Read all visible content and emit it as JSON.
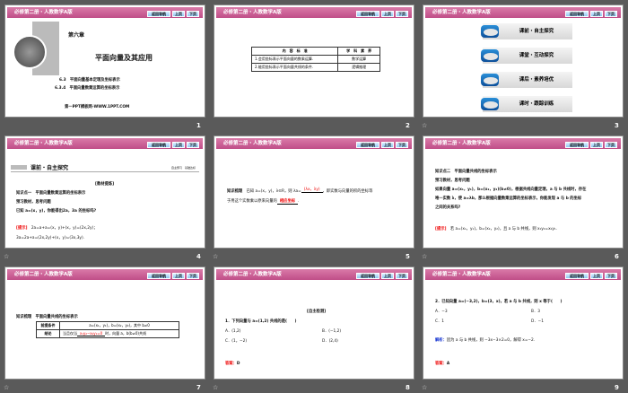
{
  "header": {
    "title": "必修第二册・人教数学A版",
    "nav_home": "返回导航",
    "nav_prev": "上页",
    "nav_next": "下页"
  },
  "slides": [
    {
      "number": "1",
      "chapter": "第六章",
      "chapter_title": "平面向量及其应用",
      "section1": "6.3　平面向量基本定理及坐标表示",
      "section2": "6.3.4　平面向量数乘运算的坐标表示",
      "footer": "第一PPT模板网-WWW.1PPT.COM"
    },
    {
      "number": "2",
      "table": {
        "headers": [
          "内　容　标　准",
          "学　科　素　养"
        ],
        "rows": [
          [
            "1.会用坐标表示平面向量的数乘运算.",
            "数学运算"
          ],
          [
            "2.能用坐标表示平面向量共线的条件.",
            "逻辑推理"
          ]
        ]
      }
    },
    {
      "number": "3",
      "menu": [
        "课前・自主探究",
        "课堂・互动探究",
        "课后・素养培优",
        "课时・跟踪训练"
      ]
    },
    {
      "number": "4",
      "section": "课前・自主探究",
      "section_right": "自主预习　基础达标",
      "label": "[教材提炼]",
      "lines": [
        "知识点一　平面向量数乘运算的坐标表示",
        "预习教材，思考问题",
        "已知 a=(x，y)，你能得出2a，3a 的坐标吗?"
      ],
      "hint": "[提示]",
      "ans1": "2a=a+a=(x，y)+(x，y)=(2x,2y)；",
      "ans2": "3a=2a+a=(2x,2y)+(x，y)=(3x,3y)."
    },
    {
      "number": "5",
      "prefix": "知识梳理",
      "text1": "已知 a=(x，y)，λ∈R，则 λa=",
      "blank1": "(λx，λy)",
      "text2": "，即实数与向量的积的坐标等",
      "text3": "于用这个实数乘以原来向量的",
      "blank2": "相应坐标",
      "text4": "."
    },
    {
      "number": "6",
      "lines": [
        "知识点二　平面向量共线的坐标表示",
        "预习教材，思考问题",
        "如果向量 a=(x₁，y₁)，b=(x₂，y₂)(b≠0)，根据共线向量定理，a 与 b 共线时，存在",
        "唯一实数 λ，使 a=λb，那么根据向量数乘运算的坐标表示，你能发现 a 与 b 的坐标",
        "之间的关系吗?"
      ],
      "hint": "[提示]",
      "answer": "若 a=(x₁，y₁)，b=(x₂，y₂)，且 a 与 b 共线，则 x₁y₂=x₂y₁."
    },
    {
      "number": "7",
      "title": "知识梳理　平面向量共线的坐标表示",
      "row1_label": "前提条件",
      "row1_value": "a=(x₁，y₁)，b=(x₂，y₂)，其中 b≠0",
      "row2_label": "结论",
      "row2_pre": "当且仅当",
      "row2_blank": "x₁y₂−x₂y₁=0",
      "row2_post": "时，向量 a，b(b≠0)共线"
    },
    {
      "number": "8",
      "label": "[自主检测]",
      "question": "1．下列向量与 a=(1,2) 共线的是(　　)",
      "options": [
        "A．(1,2)",
        "B．(−1,2)",
        "C．(1，−2)",
        "D．(2,4)"
      ],
      "answer_label": "答案：",
      "answer": "D"
    },
    {
      "number": "9",
      "question": "2．已知向量 a=(−3,2)，b=(3，x)，若 a 与 b 共线，则 x 等于(　　)",
      "options": [
        "A．−3",
        "B．3",
        "C．1",
        "D．−1"
      ],
      "analysis_label": "解析：",
      "analysis": "因为 a 与 b 共线，则 −3x−3×2=0，解得 x=−2.",
      "answer_label": "答案：",
      "answer": "A"
    }
  ],
  "anim_icon": "☆"
}
